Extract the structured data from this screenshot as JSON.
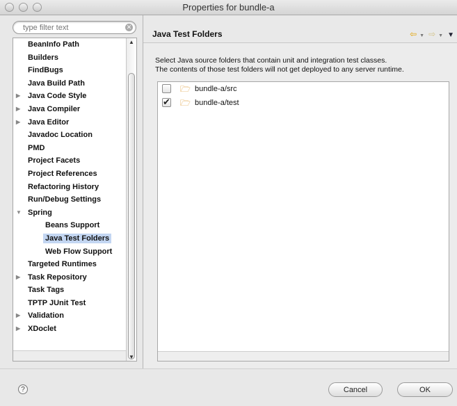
{
  "window": {
    "title": "Properties for bundle-a"
  },
  "filter": {
    "placeholder": "type filter text"
  },
  "tree": {
    "items": [
      {
        "label": "BeanInfo Path",
        "level": 0,
        "expandable": false,
        "expanded": false,
        "selected": false
      },
      {
        "label": "Builders",
        "level": 0,
        "expandable": false,
        "expanded": false,
        "selected": false
      },
      {
        "label": "FindBugs",
        "level": 0,
        "expandable": false,
        "expanded": false,
        "selected": false
      },
      {
        "label": "Java Build Path",
        "level": 0,
        "expandable": false,
        "expanded": false,
        "selected": false
      },
      {
        "label": "Java Code Style",
        "level": 0,
        "expandable": true,
        "expanded": false,
        "selected": false
      },
      {
        "label": "Java Compiler",
        "level": 0,
        "expandable": true,
        "expanded": false,
        "selected": false
      },
      {
        "label": "Java Editor",
        "level": 0,
        "expandable": true,
        "expanded": false,
        "selected": false
      },
      {
        "label": "Javadoc Location",
        "level": 0,
        "expandable": false,
        "expanded": false,
        "selected": false
      },
      {
        "label": "PMD",
        "level": 0,
        "expandable": false,
        "expanded": false,
        "selected": false
      },
      {
        "label": "Project Facets",
        "level": 0,
        "expandable": false,
        "expanded": false,
        "selected": false
      },
      {
        "label": "Project References",
        "level": 0,
        "expandable": false,
        "expanded": false,
        "selected": false
      },
      {
        "label": "Refactoring History",
        "level": 0,
        "expandable": false,
        "expanded": false,
        "selected": false
      },
      {
        "label": "Run/Debug Settings",
        "level": 0,
        "expandable": false,
        "expanded": false,
        "selected": false
      },
      {
        "label": "Spring",
        "level": 0,
        "expandable": true,
        "expanded": true,
        "selected": false
      },
      {
        "label": "Beans Support",
        "level": 1,
        "expandable": false,
        "expanded": false,
        "selected": false
      },
      {
        "label": "Java Test Folders",
        "level": 1,
        "expandable": false,
        "expanded": false,
        "selected": true
      },
      {
        "label": "Web Flow Support",
        "level": 1,
        "expandable": false,
        "expanded": false,
        "selected": false
      },
      {
        "label": "Targeted Runtimes",
        "level": 0,
        "expandable": false,
        "expanded": false,
        "selected": false
      },
      {
        "label": "Task Repository",
        "level": 0,
        "expandable": true,
        "expanded": false,
        "selected": false
      },
      {
        "label": "Task Tags",
        "level": 0,
        "expandable": false,
        "expanded": false,
        "selected": false
      },
      {
        "label": "TPTP JUnit Test",
        "level": 0,
        "expandable": false,
        "expanded": false,
        "selected": false
      },
      {
        "label": "Validation",
        "level": 0,
        "expandable": true,
        "expanded": false,
        "selected": false
      },
      {
        "label": "XDoclet",
        "level": 0,
        "expandable": true,
        "expanded": false,
        "selected": false
      }
    ]
  },
  "page": {
    "title": "Java Test Folders",
    "description_line1": "Select Java source folders that contain unit and integration test classes.",
    "description_line2": "The contents of those test folders will not get deployed to any server runtime.",
    "folders": [
      {
        "label": "bundle-a/src",
        "checked": false
      },
      {
        "label": "bundle-a/test",
        "checked": true
      }
    ]
  },
  "buttons": {
    "help": "?",
    "cancel": "Cancel",
    "ok": "OK"
  },
  "icons": {
    "collapsed": "▶",
    "expanded": "▼",
    "folder": "folder-icon",
    "back": "⇦",
    "forward": "⇨",
    "dropdown": "▼",
    "menu": "▼"
  }
}
